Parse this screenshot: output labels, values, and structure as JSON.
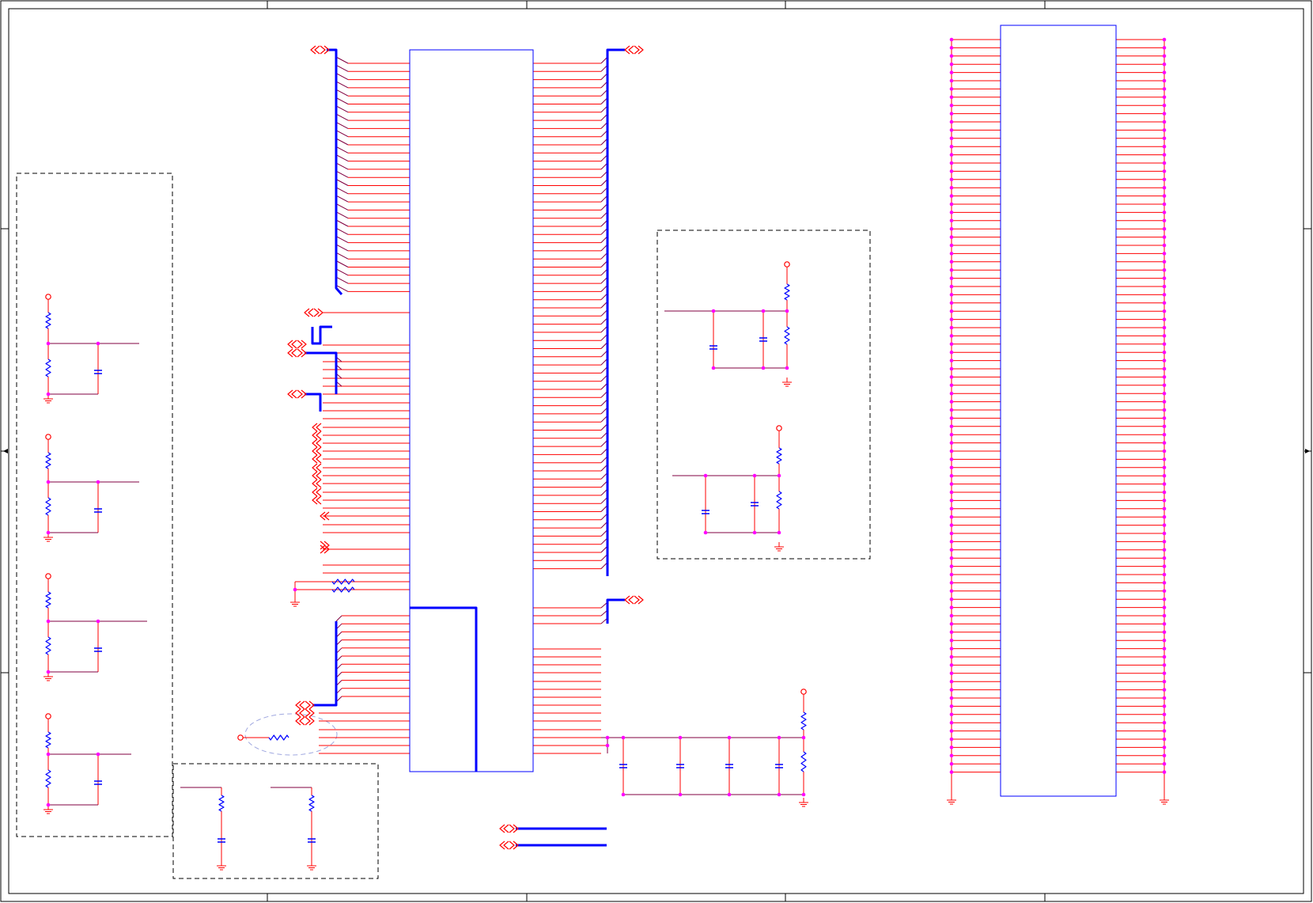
{
  "colors": {
    "paper": "#ffffff",
    "frame": "#000000",
    "wire_red": "#ff0000",
    "wire_purple": "#800040",
    "bus_blue": "#0000ff",
    "component_blue": "#0000ff",
    "junction_magenta": "#ff00ff",
    "block_border": "#000000",
    "annotation_ellipse": "#a0a8e0"
  },
  "symbols": {
    "net_port": "double-chevron-port-icon",
    "power_pin": "power-circle-icon",
    "ground": "ground-symbol-icon",
    "resistor": "zigzag-resistor-icon",
    "capacitor": "capacitor-plates-icon",
    "border_arrow": "sheet-edge-arrow-icon"
  },
  "schematic": {
    "title": ""
  }
}
